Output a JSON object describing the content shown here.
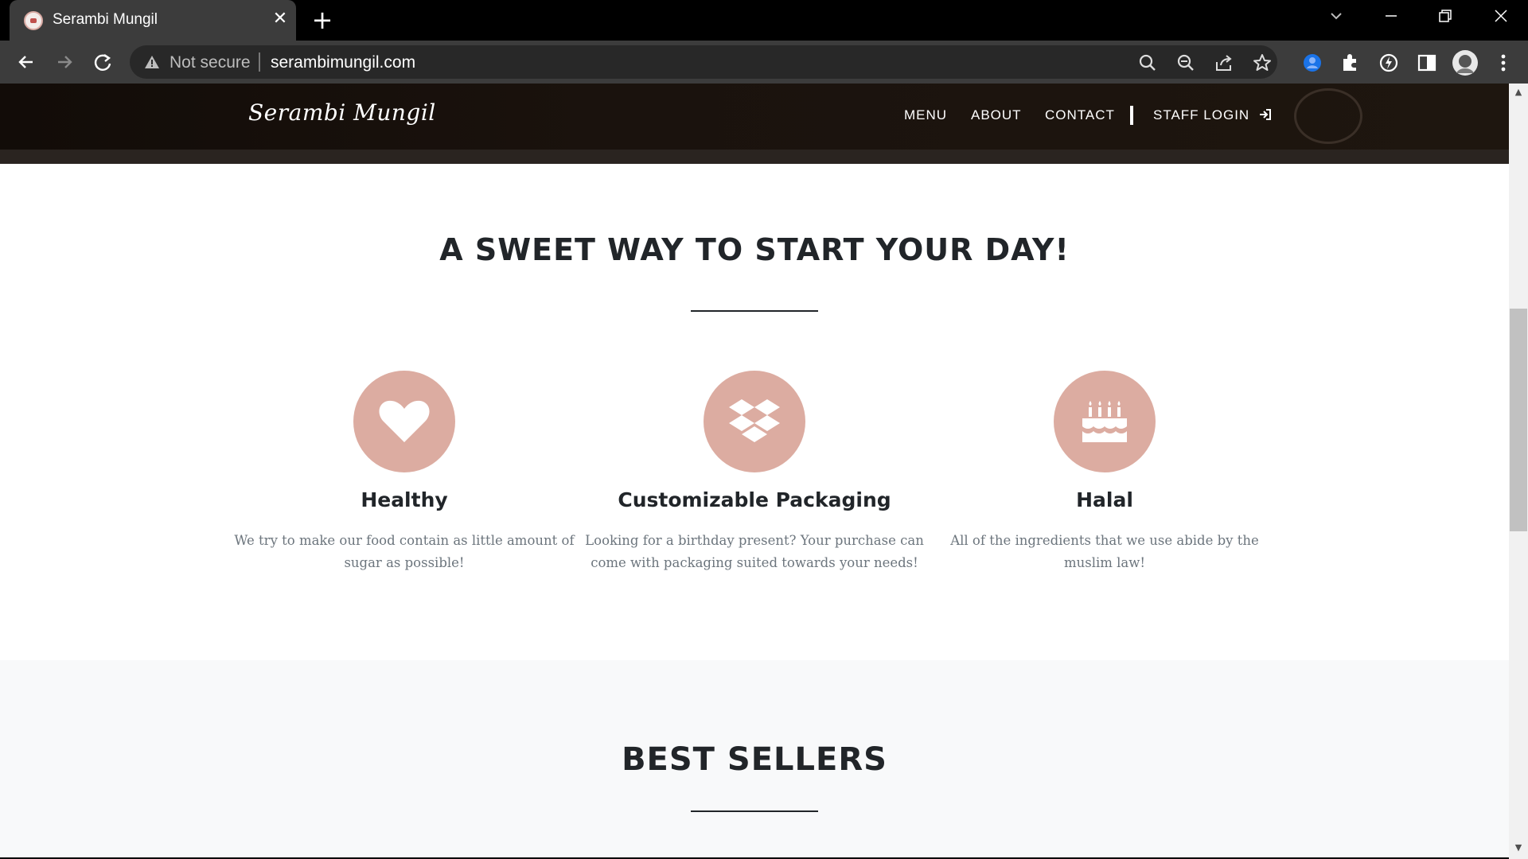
{
  "browser": {
    "tab_title": "Serambi Mungil",
    "tab_close": "✕",
    "new_tab": "+",
    "security_label": "Not secure",
    "url": "serambimungil.com"
  },
  "site": {
    "logo": "Serambi Mungil",
    "nav": {
      "menu": "MENU",
      "about": "ABOUT",
      "contact": "CONTACT",
      "staff_login": "STAFF LOGIN"
    }
  },
  "features_section": {
    "heading": "A SWEET WAY TO START YOUR DAY!",
    "items": [
      {
        "icon": "heart-icon",
        "title": "Healthy",
        "text": "We try to make our food contain as little amount of sugar as possible!"
      },
      {
        "icon": "dropbox-icon",
        "title": "Customizable Packaging",
        "text": "Looking for a birthday present? Your purchase can come with packaging suited towards your needs!"
      },
      {
        "icon": "birthday-cake-icon",
        "title": "Halal",
        "text": "All of the ingredients that we use abide by the muslim law!"
      }
    ]
  },
  "best_sellers_section": {
    "heading": "BEST SELLERS"
  },
  "colors": {
    "accent": "#dcaca1",
    "heading": "#212529",
    "body_text": "#6c757d",
    "nav_bg": "#1a120d",
    "alt_section_bg": "#f8f9fa"
  }
}
